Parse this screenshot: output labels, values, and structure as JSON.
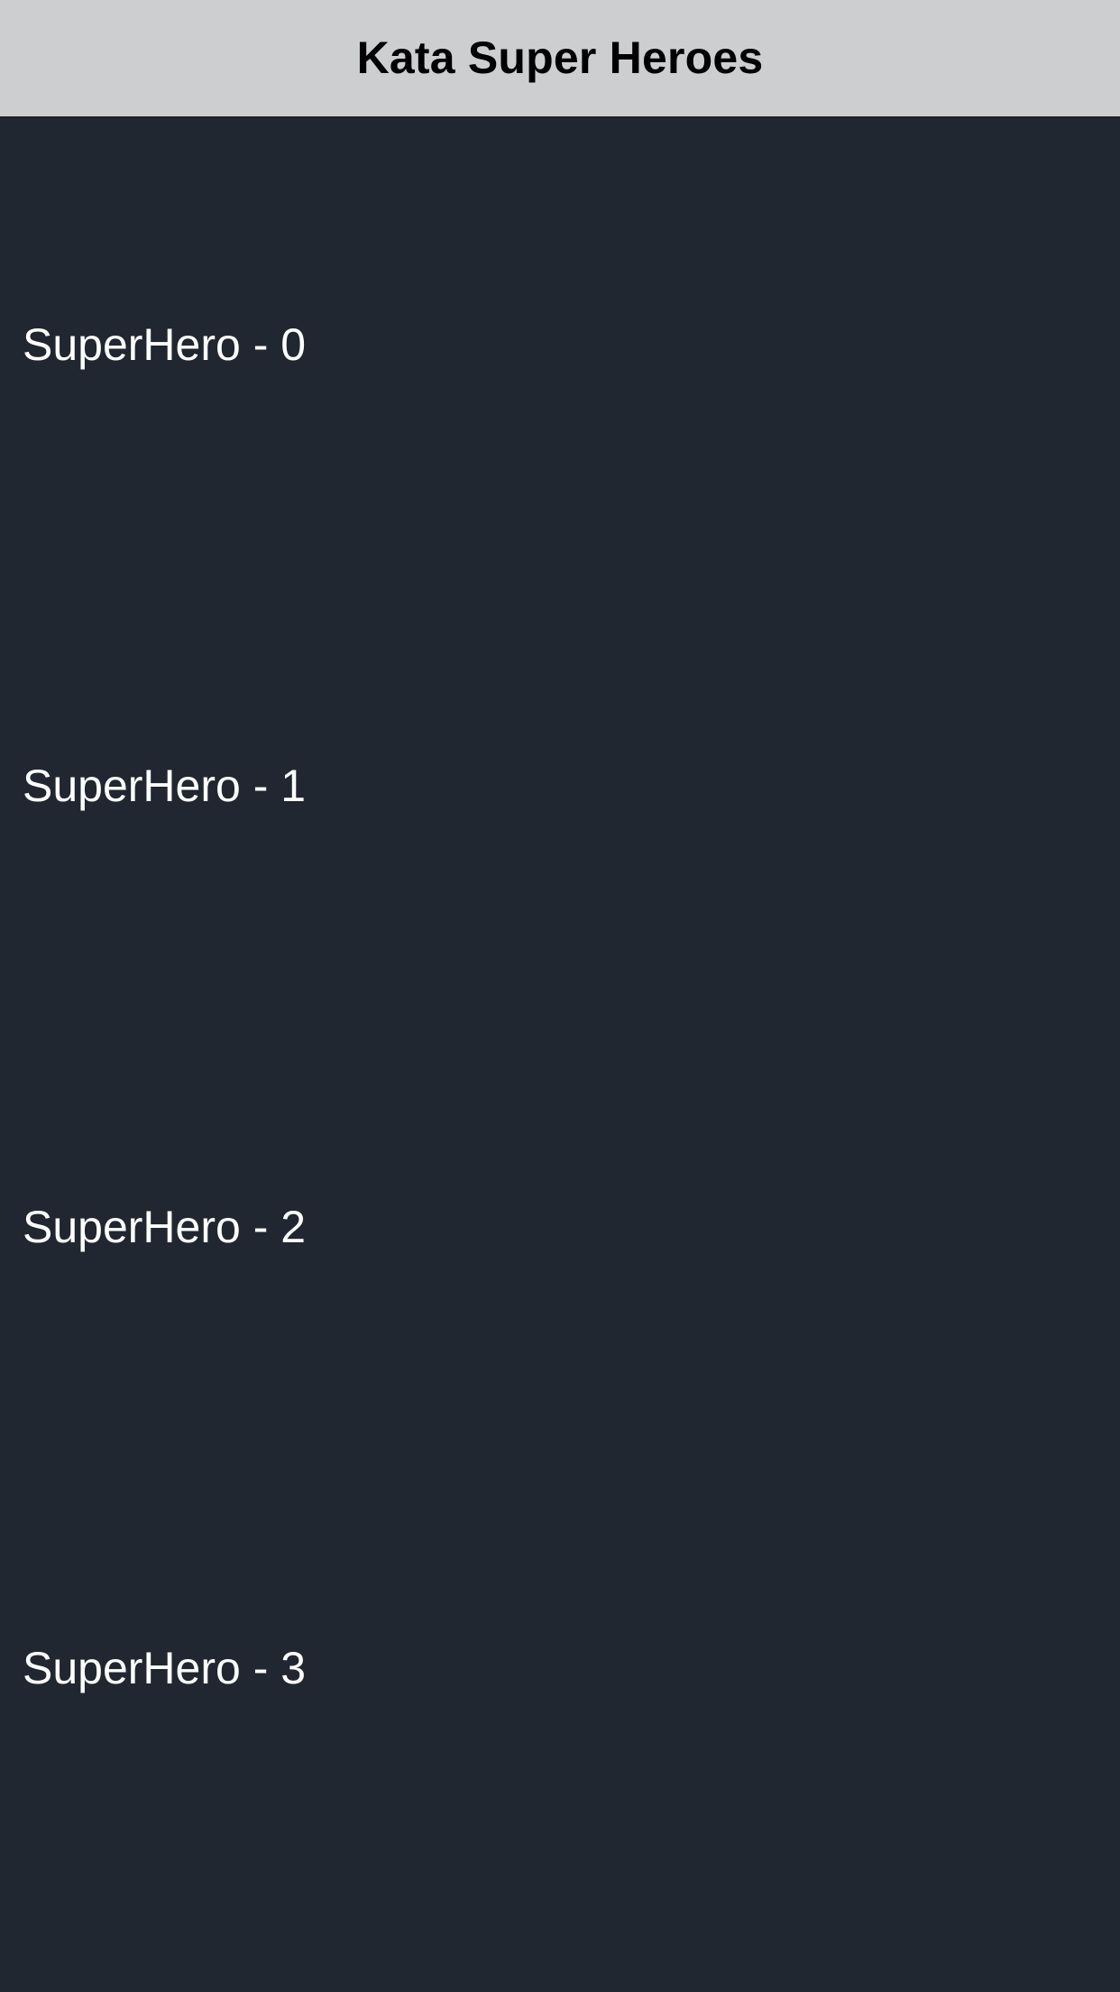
{
  "nav_bar": {
    "title": "Kata Super Heroes"
  },
  "list": {
    "items": [
      {
        "name": "SuperHero - 0"
      },
      {
        "name": "SuperHero - 1"
      },
      {
        "name": "SuperHero - 2"
      },
      {
        "name": "SuperHero - 3"
      }
    ]
  },
  "colors": {
    "nav_background": "#cdced0",
    "screen_background": "#212730",
    "title_text": "#000000",
    "item_text": "#ffffff"
  }
}
